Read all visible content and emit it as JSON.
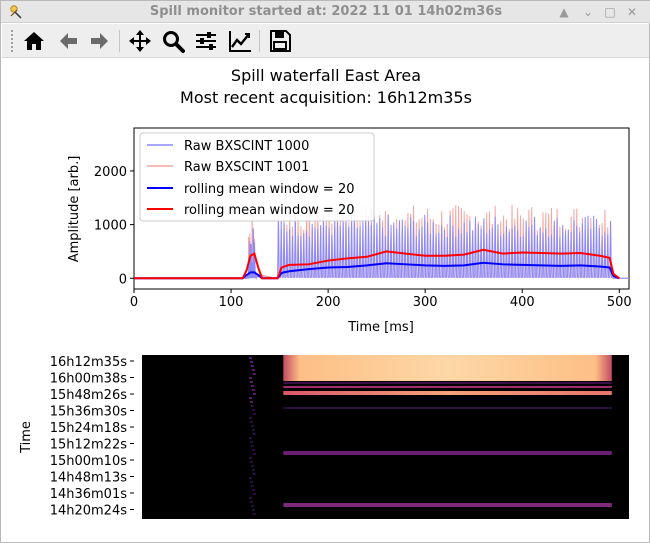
{
  "window": {
    "title": "Spill monitor started at: 2022 11 01 14h02m36s",
    "controls": [
      "▲",
      "⌄",
      "□",
      "✕"
    ]
  },
  "toolbar": {
    "tools": [
      "home-icon",
      "back-arrow-icon",
      "forward-arrow-icon",
      "pan-icon",
      "zoom-icon",
      "subplots-icon",
      "axes-edit-icon",
      "save-icon"
    ]
  },
  "figure": {
    "title_line1": "Spill waterfall East Area",
    "title_line2": "Most recent acquisition: 16h12m35s"
  },
  "chart_data": [
    {
      "type": "line",
      "xlabel": "Time [ms]",
      "ylabel": "Amplitude [arb.]",
      "xlim": [
        0,
        510
      ],
      "ylim": [
        -200,
        2800
      ],
      "xticks": [
        0,
        100,
        200,
        300,
        400,
        500
      ],
      "yticks": [
        0,
        1000,
        2000
      ],
      "legend_position": "top-left",
      "colors": {
        "raw_1000": "#8a8aff",
        "raw_1001": "#f4a6a0",
        "mean_1000": "#0000ff",
        "mean_1001": "#ff0000"
      },
      "series": [
        {
          "name": "Raw BXSCINT 1000",
          "description": "spiky raw signal, ~0 until 115 ms, burst 115-125 ms (peaks ~1000), extraction 148-492 ms with peaks ~1000-1200"
        },
        {
          "name": "Raw BXSCINT 1001",
          "description": "spiky raw signal, burst 115-125 ms (peak ~1200), extraction 148-492 ms with peaks ~1000-1400"
        },
        {
          "name": "rolling mean window = 20",
          "x": [
            0,
            112,
            116,
            120,
            124,
            128,
            132,
            148,
            152,
            160,
            180,
            200,
            220,
            240,
            260,
            280,
            300,
            320,
            340,
            360,
            380,
            400,
            420,
            440,
            460,
            480,
            490,
            494,
            500
          ],
          "values": [
            0,
            0,
            60,
            110,
            110,
            60,
            0,
            0,
            100,
            130,
            170,
            200,
            210,
            240,
            280,
            260,
            240,
            230,
            240,
            290,
            260,
            250,
            240,
            230,
            240,
            220,
            200,
            40,
            0
          ]
        },
        {
          "name": "rolling mean window = 20",
          "x": [
            0,
            112,
            116,
            120,
            124,
            128,
            132,
            148,
            152,
            160,
            180,
            200,
            220,
            240,
            260,
            280,
            300,
            320,
            340,
            360,
            380,
            400,
            420,
            440,
            460,
            480,
            490,
            494,
            500
          ],
          "values": [
            0,
            0,
            150,
            420,
            460,
            200,
            0,
            0,
            200,
            250,
            260,
            330,
            370,
            400,
            500,
            460,
            420,
            420,
            440,
            530,
            460,
            480,
            470,
            460,
            470,
            420,
            380,
            80,
            0
          ]
        }
      ]
    },
    {
      "type": "heatmap",
      "ylabel": "Time",
      "ytick_labels": [
        "16h12m35s",
        "16h00m38s",
        "15h48m26s",
        "15h36m30s",
        "15h24m18s",
        "15h12m22s",
        "15h00m10s",
        "14h48m13s",
        "14h36m01s",
        "14h20m24s"
      ],
      "colormap": "magma",
      "description": "waterfall of spill profiles, most recent at top, bright band at top rows between ~148 and 492 ms"
    }
  ]
}
